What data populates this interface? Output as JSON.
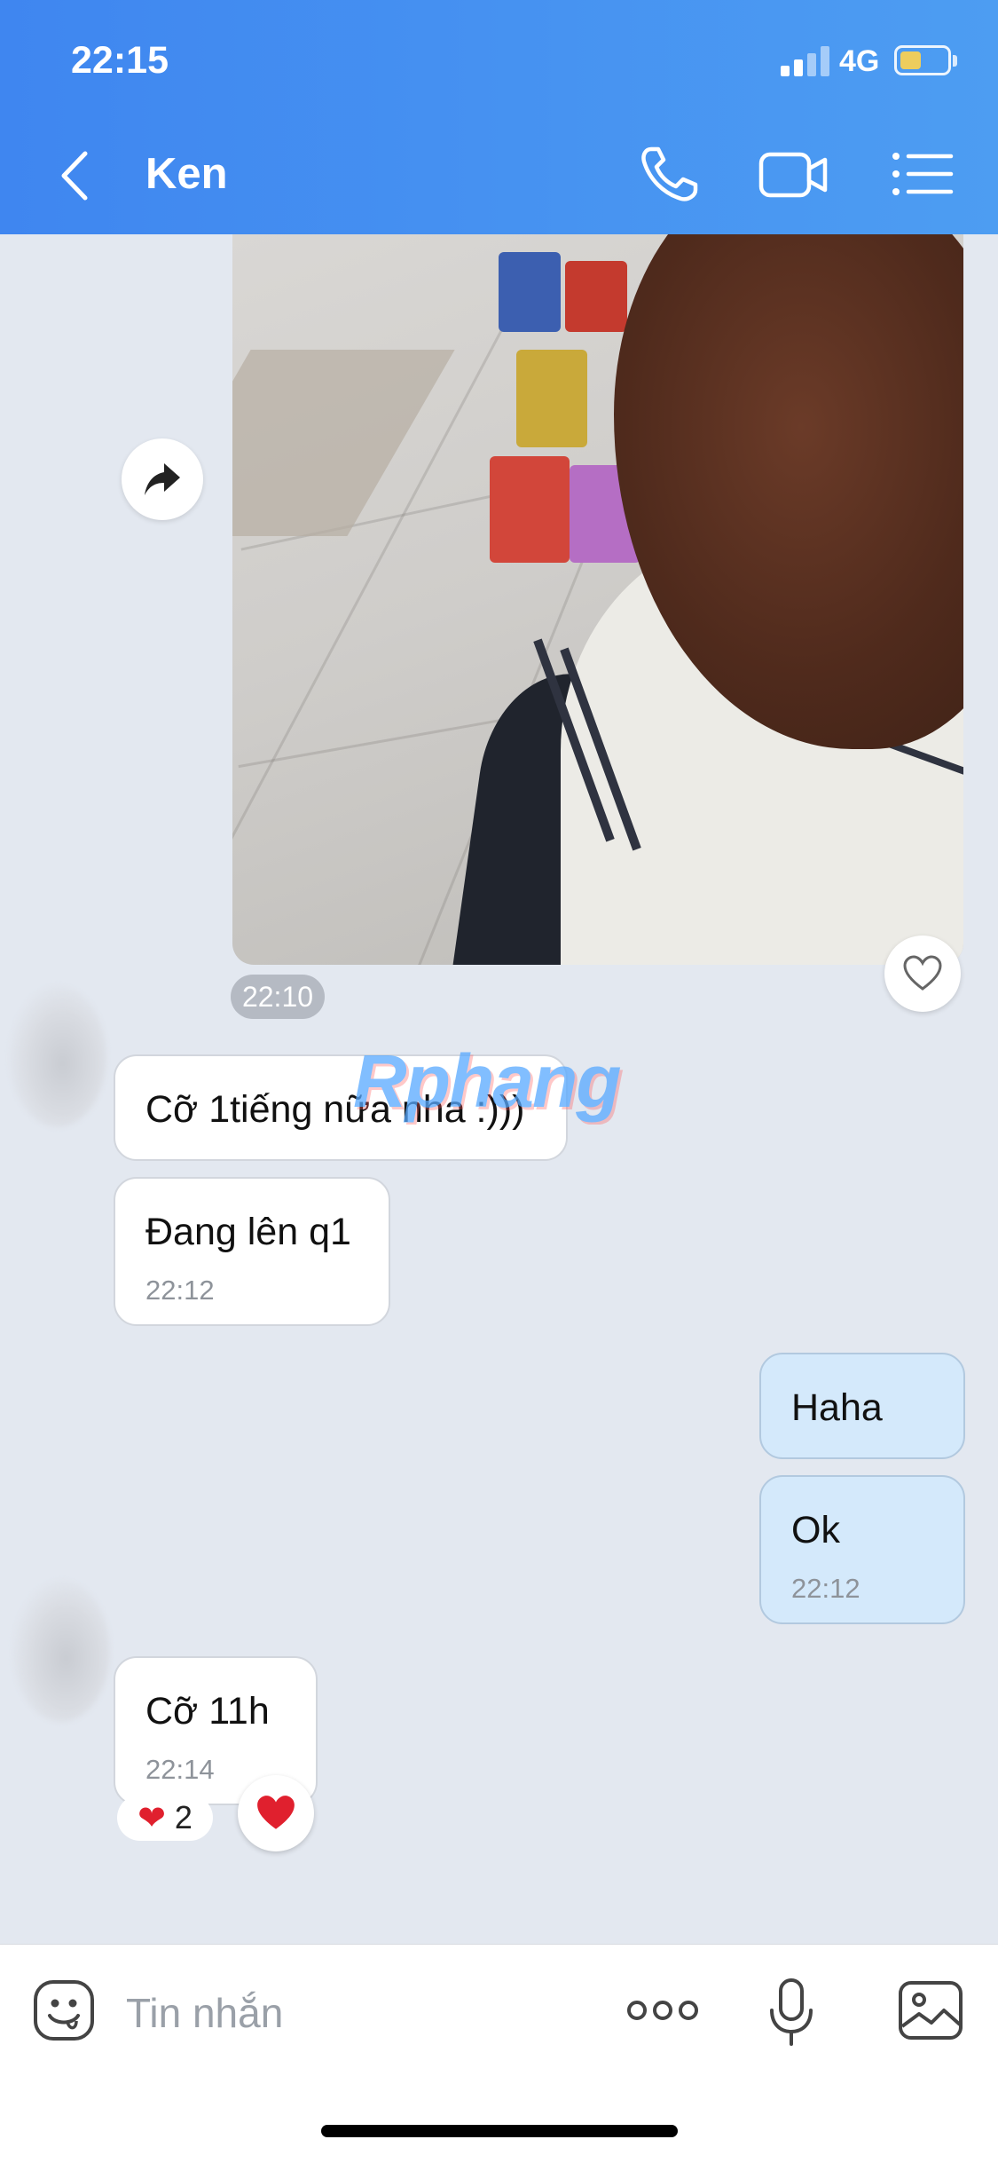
{
  "status_bar": {
    "time": "22:15",
    "network": "4G",
    "battery_level": 0.45
  },
  "header": {
    "contact_name": "Ken",
    "icons": [
      "back-icon",
      "phone-icon",
      "video-call-icon",
      "menu-list-icon"
    ]
  },
  "photo_message": {
    "time": "22:10",
    "icons": [
      "share-icon",
      "heart-outline-icon"
    ]
  },
  "watermark": "Rphang",
  "messages": [
    {
      "direction": "incoming",
      "text": "Cỡ 1tiếng nữa nha :)))",
      "time": ""
    },
    {
      "direction": "incoming",
      "text": "Đang lên q1",
      "time": "22:12"
    },
    {
      "direction": "outgoing",
      "text": "Haha",
      "time": ""
    },
    {
      "direction": "outgoing",
      "text": "Ok",
      "time": "22:12"
    },
    {
      "direction": "incoming",
      "text": "Cỡ 11h",
      "time": "22:14"
    }
  ],
  "reaction": {
    "emoji": "❤",
    "count": "2"
  },
  "input_bar": {
    "placeholder": "Tin nhắn",
    "icons": [
      "emoji-icon",
      "more-icon",
      "mic-icon",
      "image-icon"
    ]
  },
  "colors": {
    "header": "#4291f0",
    "background": "#e3e8f0",
    "outgoing_bubble": "#d4e9fb",
    "incoming_bubble": "#ffffff"
  }
}
